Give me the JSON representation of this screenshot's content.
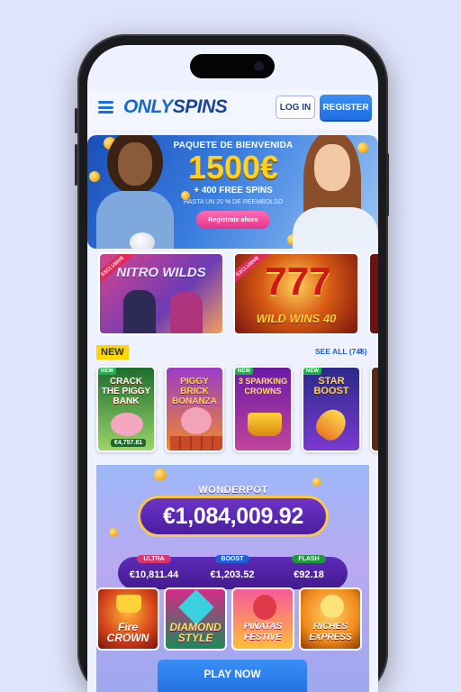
{
  "header": {
    "logo_only": "ONLY",
    "logo_spins": "SPINS",
    "login_label": "LOG IN",
    "register_label": "REGISTER"
  },
  "hero": {
    "kicker": "PAQUETE DE BIENVENIDA",
    "amount": "1500€",
    "spins": "+ 400 FREE SPINS",
    "note": "HASTA UN 20 % DE REEMBOLSO",
    "cta": "Regístrate ahora"
  },
  "promos": [
    {
      "badge": "EXCLUSIVE",
      "title": "NITRO WILDS"
    },
    {
      "badge": "EXCLUSIVE",
      "title": "WILD WINS 40"
    }
  ],
  "new_section": {
    "badge": "NEW",
    "see_all": "SEE ALL (745)",
    "games": [
      {
        "tag": "NEW",
        "title": "CRACK THE PIGGY BANK",
        "prize": "€4,757.81"
      },
      {
        "tag": "",
        "title": "PIGGY BRICK BONANZA",
        "prize": ""
      },
      {
        "tag": "NEW",
        "title": "3 SPARKING CROWNS",
        "prize": ""
      },
      {
        "tag": "NEW",
        "title": "STAR BOOST",
        "prize": ""
      }
    ]
  },
  "wonderpot": {
    "title": "WONDERPOT",
    "amount": "€1,084,009.92",
    "tiers": [
      {
        "label": "ULTRA",
        "value": "€10,811.44",
        "color": "#d8356f"
      },
      {
        "label": "BOOST",
        "value": "€1,203.52",
        "color": "#1e5ed6"
      },
      {
        "label": "FLASH",
        "value": "€92.18",
        "color": "#1f9a3a"
      }
    ],
    "games": [
      {
        "title": "Fire CROWN"
      },
      {
        "title": "DIAMOND STYLE"
      },
      {
        "title": "PIÑATAS FESTIVE"
      },
      {
        "title": "RICHES EXPRESS"
      }
    ],
    "play_label": "PLAY NOW"
  },
  "colors": {
    "brand_blue": "#1f6ee0",
    "new_yellow": "#ffd600",
    "accent_pink": "#e6338a"
  }
}
